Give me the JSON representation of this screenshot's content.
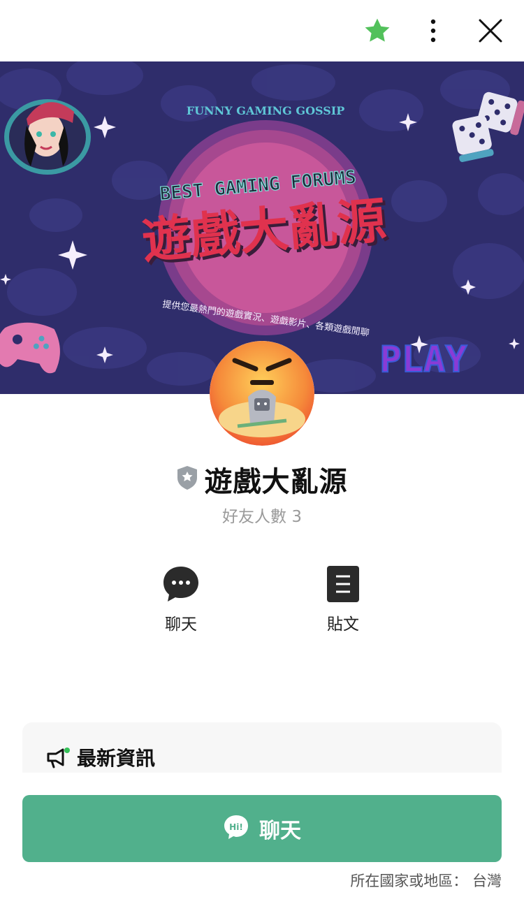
{
  "header": {
    "icons": [
      "star-icon",
      "more-vertical-icon",
      "close-icon"
    ],
    "star_color": "#52c15b"
  },
  "cover": {
    "arc_text": "FUNNY  GAMING  GOSSIP",
    "banner_text": "BEST GAMING FORUMS",
    "title": "遊戲大亂源",
    "subtitle": "提供您最熱門的遊戲實況、遊戲影片、各類遊戲閒聊",
    "play_text": "PLAY"
  },
  "profile": {
    "name": "遊戲大亂源",
    "friends": "好友人數 3"
  },
  "actions": {
    "chat": "聊天",
    "posts": "貼文"
  },
  "news": {
    "title": "最新資訊"
  },
  "cta": {
    "icon_text": "Hi!",
    "label": "聊天"
  },
  "region": {
    "text": "所在國家或地區： 台灣"
  },
  "colors": {
    "accent_green": "#51b08c",
    "cover_bg": "#2f2d6b",
    "title_red": "#e0324e"
  }
}
